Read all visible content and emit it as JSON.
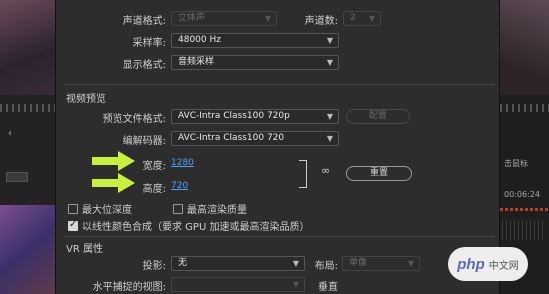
{
  "audio": {
    "channel_format_label": "声道格式:",
    "channel_format_value": "立体声",
    "channels_label": "声道数:",
    "channels_value": "2",
    "sample_rate_label": "采样率:",
    "sample_rate_value": "48000 Hz",
    "display_format_label": "显示格式:",
    "display_format_value": "音频采样"
  },
  "video_preview": {
    "section_title": "视频预览",
    "preview_file_format_label": "预览文件格式:",
    "preview_file_format_value": "AVC-Intra Class100 720p",
    "configure_button": "配置",
    "codec_label": "编解码器:",
    "codec_value": "AVC-Intra Class100 720",
    "width_label": "宽度:",
    "width_value": "1280",
    "height_label": "高度:",
    "height_value": "720",
    "reset_button": "重置",
    "max_bit_depth_label": "最大位深度",
    "max_bit_depth_checked": false,
    "max_render_quality_label": "最高渲染质量",
    "max_render_quality_checked": false,
    "linear_color_label": "以线性颜色合成（要求 GPU 加速或最高渲染品质）",
    "linear_color_checked": true
  },
  "vr": {
    "section_title": "VR 属性",
    "projection_label": "投影:",
    "projection_value": "无",
    "layout_label": "布局:",
    "layout_value": "单像",
    "horizontal_view_label": "水平捕捉的视图:",
    "vertical_label": "垂直"
  },
  "background_right": {
    "text1": "击鼠标",
    "text2": "00:06:24"
  },
  "watermark": {
    "brand": "php",
    "suffix": "中文网"
  },
  "colors": {
    "arrow_highlight": "#c8f03c",
    "link_blue": "#4aa3ff",
    "dialog_bg": "#2d2d2d"
  }
}
